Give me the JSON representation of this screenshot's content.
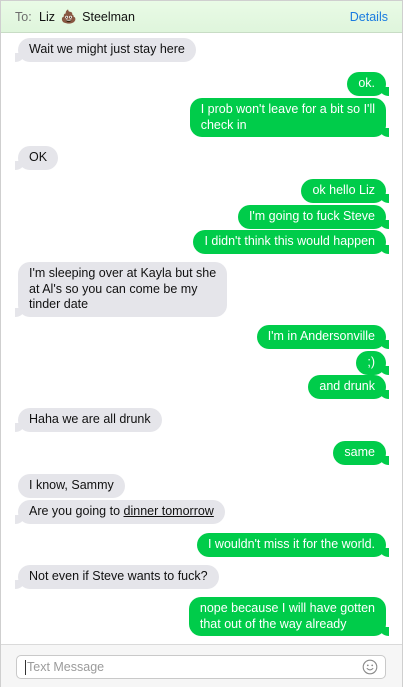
{
  "header": {
    "to_label": "To:",
    "recipient_first": "Liz",
    "recipient_emoji": "💩",
    "recipient_last": "Steelman",
    "details_label": "Details"
  },
  "messages": [
    {
      "dir": "in",
      "text": "Wait we might just stay here"
    },
    {
      "dir": "out",
      "text": "ok."
    },
    {
      "dir": "out",
      "lines": [
        "I prob won't leave for a bit so I'll",
        "check in"
      ]
    },
    {
      "dir": "in",
      "text": "OK"
    },
    {
      "dir": "out",
      "text": "ok hello Liz"
    },
    {
      "dir": "out",
      "text": "I'm going to fuck Steve"
    },
    {
      "dir": "out",
      "text": "I didn't think this would happen"
    },
    {
      "dir": "in",
      "lines": [
        "I'm sleeping over at Kayla but she",
        "at Al's so you can come be my",
        "tinder date"
      ]
    },
    {
      "dir": "out",
      "text": "I'm in Andersonville"
    },
    {
      "dir": "out",
      "text": ";)"
    },
    {
      "dir": "out",
      "text": "and drunk"
    },
    {
      "dir": "in",
      "text": "Haha we are all drunk"
    },
    {
      "dir": "out",
      "text": "same"
    },
    {
      "dir": "in",
      "text": "I know, Sammy"
    },
    {
      "dir": "in",
      "prefix": "Are you going to ",
      "link": "dinner tomorrow"
    },
    {
      "dir": "out",
      "text": "I wouldn't miss it for the world."
    },
    {
      "dir": "in",
      "text": "Not even if Steve wants to fuck?"
    },
    {
      "dir": "out",
      "lines": [
        "nope because I will have gotten",
        "that out of the way already"
      ]
    }
  ],
  "composer": {
    "placeholder": "Text Message",
    "emoji_icon": "smiley-face-icon"
  },
  "colors": {
    "outgoing": "#00cc4a",
    "incoming": "#e5e5ea",
    "header": "#e2f7df",
    "link": "#1a7be0"
  }
}
